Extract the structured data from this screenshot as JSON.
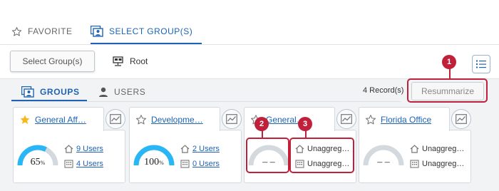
{
  "top_tabs": [
    {
      "label": "FAVORITE",
      "icon": "star-outline-icon",
      "active": false
    },
    {
      "label": "SELECT GROUP(S)",
      "icon": "group-select-icon",
      "active": true
    }
  ],
  "toolbar": {
    "select_groups_label": "Select Group(s)",
    "root_label": "Root",
    "root_icon": "hierarchy-icon",
    "list_icon": "list-view-icon"
  },
  "sub_tabs": [
    {
      "label": "GROUPS",
      "icon": "group-select-icon",
      "active": true
    },
    {
      "label": "USERS",
      "icon": "user-icon",
      "active": false
    }
  ],
  "records_label": "4 Record(s)",
  "resummarize_label": "Resummarize",
  "colors": {
    "accent": "#1e63b4",
    "gauge": "#29b6f6",
    "gauge_track": "#d4d9de",
    "callout": "#c0203a",
    "favorite_star": "#f6b81a"
  },
  "cards": [
    {
      "title": "General Aff…",
      "favorite": true,
      "gauge_percent": 65,
      "value": "65",
      "unit": "%",
      "users_text": "9 Users",
      "groups_text": "4 Users",
      "linked": true
    },
    {
      "title": "Developme…",
      "favorite": false,
      "gauge_percent": 100,
      "value": "100",
      "unit": "%",
      "users_text": "2 Users",
      "groups_text": "0 Users",
      "linked": true
    },
    {
      "title": "General…",
      "favorite": false,
      "gauge_percent": 0,
      "value": "– –",
      "unit": "",
      "users_text": "Unaggreg…",
      "groups_text": "Unaggreg…",
      "linked": false
    },
    {
      "title": "Florida Office",
      "favorite": false,
      "gauge_percent": 0,
      "value": "– –",
      "unit": "",
      "users_text": "Unaggreg…",
      "groups_text": "Unaggreg…",
      "linked": false
    }
  ],
  "callouts": [
    "1",
    "2",
    "3"
  ]
}
